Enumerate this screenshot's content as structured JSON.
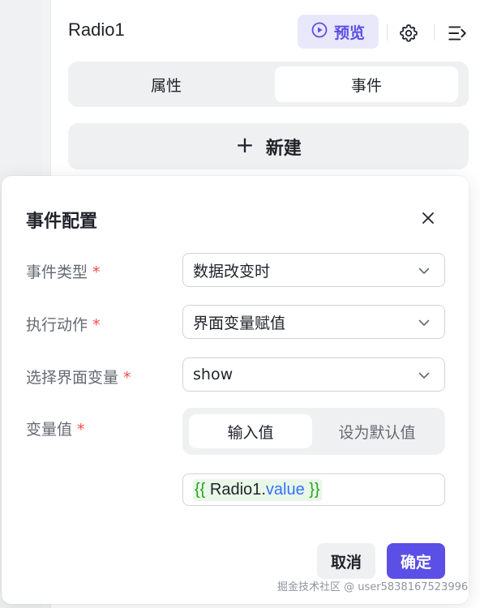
{
  "panel": {
    "title": "Radio1",
    "preview_label": "预览",
    "tabs": [
      {
        "label": "属性",
        "active": false
      },
      {
        "label": "事件",
        "active": true
      }
    ],
    "new_label": "新建"
  },
  "dialog": {
    "title": "事件配置",
    "fields": [
      {
        "label": "事件类型",
        "required_mark": "*",
        "value": "数据改变时"
      },
      {
        "label": "执行动作",
        "required_mark": "*",
        "value": "界面变量赋值"
      },
      {
        "label": "选择界面变量",
        "required_mark": "*",
        "value": "show"
      },
      {
        "label": "变量值",
        "required_mark": "*"
      }
    ],
    "value_mode_tabs": [
      {
        "label": "输入值",
        "active": true
      },
      {
        "label": "设为默认值",
        "active": false
      }
    ],
    "expression": {
      "open": "{{",
      "object": "Radio1",
      "dot": ".",
      "property": "value",
      "close": "}}"
    },
    "cancel_label": "取消",
    "confirm_label": "确定"
  },
  "watermark": "掘金技术社区 @ user5838167523996",
  "icons": {
    "preview": "play-circle-icon",
    "settings": "gear-icon",
    "collapse": "collapse-right-icon",
    "close": "close-icon",
    "dropdown": "chevron-down-icon"
  },
  "colors": {
    "accent": "#5b4fe6",
    "accent_light": "#e9e8fb",
    "required": "#f54a45",
    "expr_brace": "#2ea121",
    "expr_property": "#3370ff"
  }
}
